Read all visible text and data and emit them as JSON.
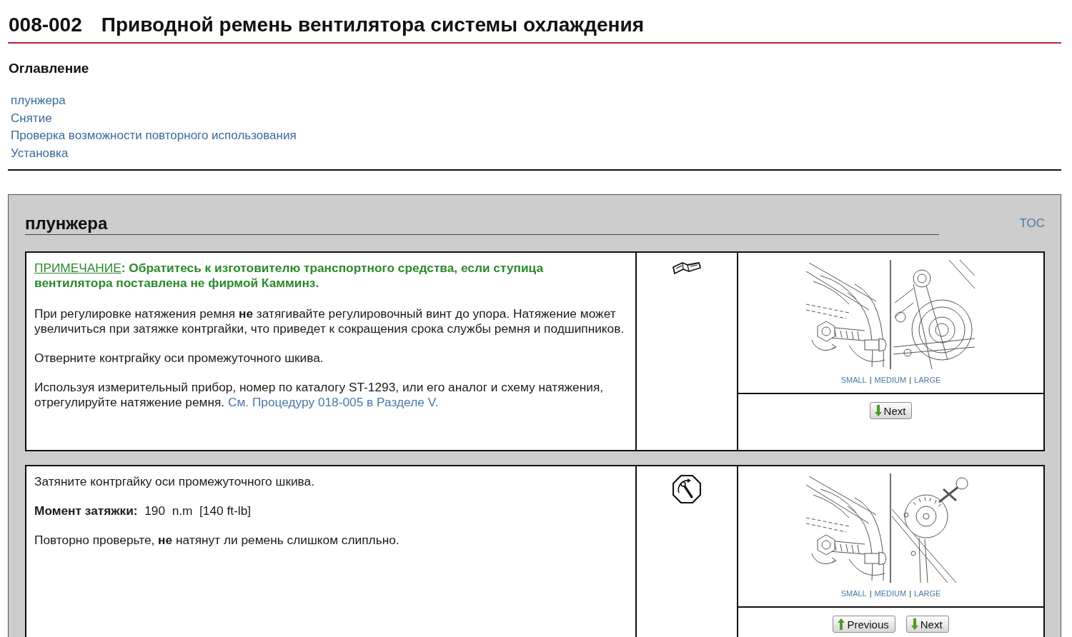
{
  "header": {
    "code": "008-002",
    "title": "Приводной ремень вентилятора системы охлаждения"
  },
  "contents": {
    "heading": "Оглавление",
    "links": [
      "плунжера",
      "Снятие",
      "Проверка возможности повторного использования",
      "Установка"
    ]
  },
  "section": {
    "title": "плунжера",
    "toc_link": "TOC",
    "steps": [
      {
        "kind": "reference",
        "paragraphs": [
          {
            "kind": "note",
            "label": "ПРИМЕЧАНИЕ",
            "text": ": Обратитесь к изготовителю транспортного средства, если ступица вентилятора поставлена не фирмой Камминз."
          },
          {
            "kind": "text",
            "text": "При регулировке натяжения ремня **не** затягивайте регулировочный винт до упора. Натяжение может увеличиться при затяжке контргайки, что приведет к сокращения срока службы ремня и подшипников."
          },
          {
            "kind": "text",
            "text": "Отверните контргайку оси промежуточного шкива."
          },
          {
            "kind": "text",
            "text": "Используя измерительный прибор, номер по каталогу ST-1293, или его аналог и схему натяжения, отрегулируйте натяжение ремня.",
            "link": "См. Процедуру 018-005 в Разделе V."
          }
        ],
        "size_links": [
          "SMALL",
          "MEDIUM",
          "LARGE"
        ],
        "size_separator": "|",
        "buttons": [
          {
            "kind": "next",
            "label": "Next"
          }
        ]
      },
      {
        "kind": "torque",
        "paragraphs": [
          {
            "kind": "text",
            "text": "Затяните контргайку оси промежуточного шкива."
          },
          {
            "kind": "text",
            "text": "**Момент затяжки:**  190  n.m  [140 ft-lb]"
          },
          {
            "kind": "text",
            "text": "Повторно проверьте, **не** натянут ли ремень слишком слипльно."
          }
        ],
        "size_links": [
          "SMALL",
          "MEDIUM",
          "LARGE"
        ],
        "size_separator": "|",
        "buttons": [
          {
            "kind": "previous",
            "label": "Previous"
          },
          {
            "kind": "next",
            "label": "Next"
          }
        ]
      }
    ]
  }
}
